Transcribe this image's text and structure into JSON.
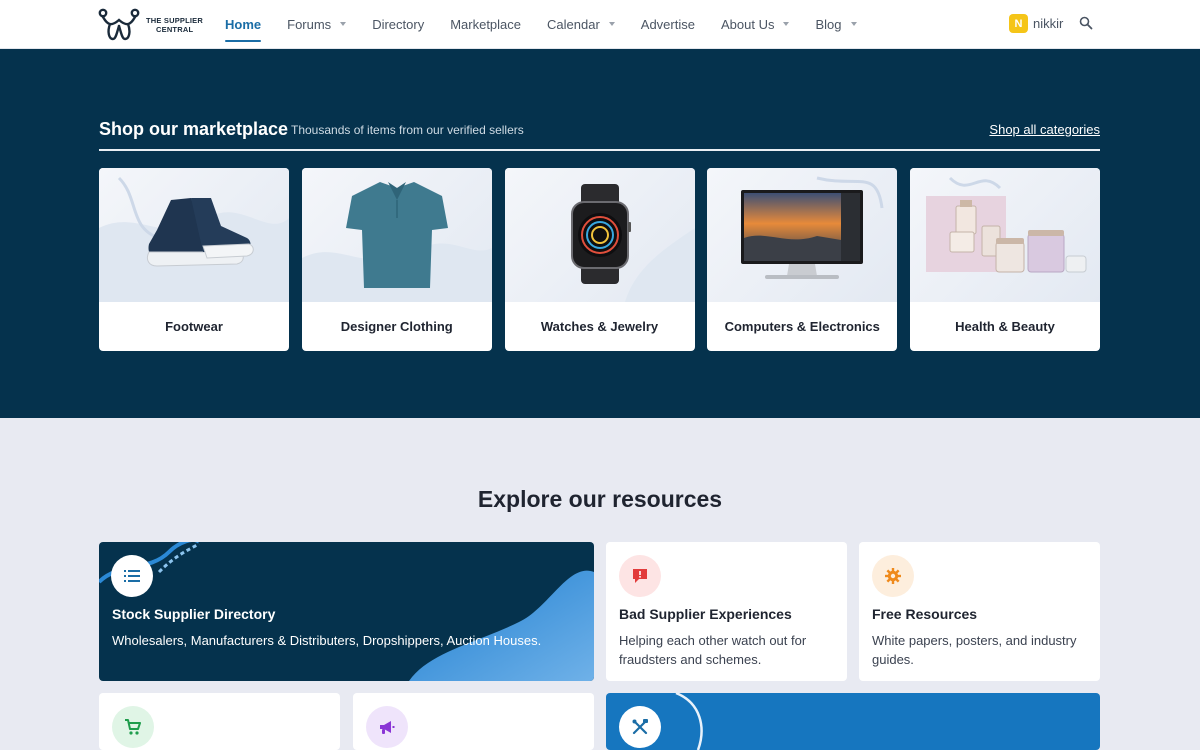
{
  "nav": {
    "logo_line1": "THE SUPPLIER",
    "logo_line2": "CENTRAL",
    "items": [
      {
        "label": "Home",
        "active": true,
        "dropdown": false
      },
      {
        "label": "Forums",
        "active": false,
        "dropdown": true
      },
      {
        "label": "Directory",
        "active": false,
        "dropdown": false
      },
      {
        "label": "Marketplace",
        "active": false,
        "dropdown": false
      },
      {
        "label": "Calendar",
        "active": false,
        "dropdown": true
      },
      {
        "label": "Advertise",
        "active": false,
        "dropdown": false
      },
      {
        "label": "About Us",
        "active": false,
        "dropdown": true
      },
      {
        "label": "Blog",
        "active": false,
        "dropdown": true
      }
    ],
    "user_initial": "N",
    "username": "nikkir",
    "accent": "#1a6da6"
  },
  "marketplace": {
    "title": "Shop our marketplace",
    "subtitle": "Thousands of items from our verified sellers",
    "link": "Shop all categories",
    "background": "#05324d",
    "categories": [
      {
        "label": "Footwear",
        "icon": "sneaker-image"
      },
      {
        "label": "Designer Clothing",
        "icon": "polo-shirt-image"
      },
      {
        "label": "Watches & Jewelry",
        "icon": "smartwatch-image"
      },
      {
        "label": "Computers & Electronics",
        "icon": "monitor-image"
      },
      {
        "label": "Health & Beauty",
        "icon": "cosmetics-image"
      }
    ]
  },
  "resources": {
    "title": "Explore our resources",
    "items": [
      {
        "title": "Stock Supplier Directory",
        "text": "Wholesalers, Manufacturers & Distributers, Dropshippers, Auction Houses.",
        "icon": "list-icon"
      },
      {
        "title": "Bad Supplier Experiences",
        "text_line1": "Helping each other watch out for",
        "text_line2": "fraudsters and schemes.",
        "icon": "chat-alert-icon"
      },
      {
        "title": "Free Resources",
        "text_line1": "White papers, posters, and industry",
        "text_line2": "guides.",
        "icon": "gear-icon"
      },
      {
        "icon": "cart-icon"
      },
      {
        "icon": "megaphone-icon"
      },
      {
        "icon": "tools-icon"
      }
    ]
  }
}
